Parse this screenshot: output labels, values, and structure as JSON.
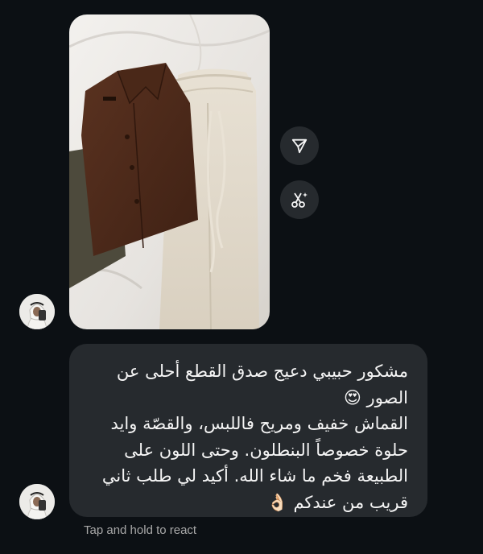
{
  "message": {
    "text": "مشكور حبيبي دعيج صدق القطع أحلى عن الصور 😍\nالقماش خفيف ومريح فاللبس، والقصّة وايد حلوة خصوصاً البنطلون. وحتى اللون على الطبيعة فخم ما شاء الله. أكيد لي طلب ثاني قريب من عندكم 👌🏻"
  },
  "hint": "Tap and hold to react",
  "icons": {
    "share": "paper-plane-icon",
    "remix": "scissors-sparkle-icon"
  },
  "colors": {
    "background": "#0c1014",
    "bubble": "#262a2e",
    "action_button": "#262a2e",
    "text": "#f5f5f5",
    "hint": "#a8a8a8"
  }
}
